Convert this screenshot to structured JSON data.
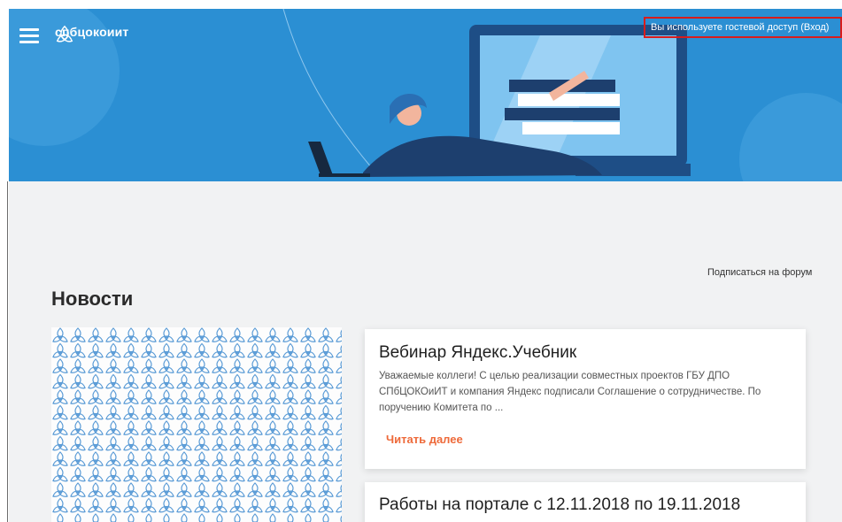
{
  "header": {
    "brand_name": "спбцокоиит",
    "guest_notice": "Вы используете гостевой доступ (Вход)"
  },
  "icons": {
    "menu": "hamburger-menu-icon",
    "logo": "triquetra-logo-icon"
  },
  "colors": {
    "banner": "#2b8fd3",
    "accent": "#ee6a3a",
    "guest_border": "#d91c1c",
    "pattern": "#5a9bd6"
  },
  "main": {
    "subscribe_link": "Подписаться на форум",
    "section_title": "Новости",
    "news": [
      {
        "title": "Вебинар Яндекс.Учебник",
        "excerpt": "Уважаемые коллеги! С целью реализации совместных проектов ГБУ ДПО СПбЦОКОиИТ и компания Яндекс подписали Соглашение о сотрудничестве. По поручению Комитета по ...",
        "read_more": "Читать далее"
      },
      {
        "title": "Работы на портале с 12.11.2018 по 19.11.2018"
      }
    ]
  }
}
